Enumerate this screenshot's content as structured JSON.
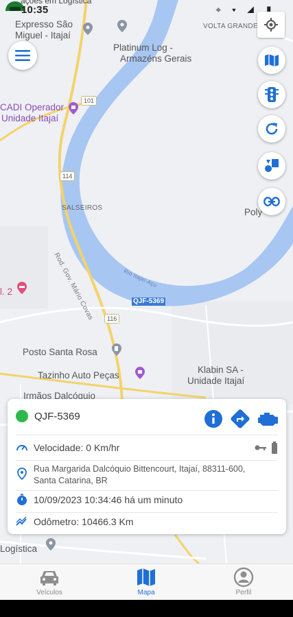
{
  "status_bar": {
    "time": "10:35",
    "icons": "⌖ ▾ ◢ ▮",
    "cut_label": "ações em Logística"
  },
  "map": {
    "labels": {
      "expresso": "Expresso São",
      "miguel": "Miguel - Itajaí",
      "platinum1": "Platinum Log -",
      "platinum2": "Armazéns Gerais",
      "volta": "VOLTA GRANDE",
      "cadi1": "CADI Operador",
      "cadi2": "Unidade Itajaí",
      "salseiros": "SALSEIROS",
      "poly": "Poly",
      "rod": "Rod. Gov. Mário Covas",
      "rio": "Rio Itajaí-Açu",
      "pink2": "l. 2",
      "posto": "Posto Santa Rosa",
      "tazinho": "Tazinho Auto Peças",
      "irmaos": "Irmãos Dalcóquio",
      "klabin1": "Klabin SA -",
      "klabin2": "Unidade Itajaí",
      "logistica": "Logística",
      "r101": "101",
      "r114": "114",
      "r116": "116"
    },
    "vehicle_plate_label": "QJF-5369"
  },
  "colors": {
    "river": "#a8c6f2",
    "accent": "#1f6fd6",
    "status_green": "#2eb84b",
    "road_yellow": "#f3d36b"
  },
  "card": {
    "plate": "QJF-5369",
    "speed": "Velocidade: 0 Km/hr",
    "address_line1": "Rua Margarida Dalcóquio Bittencourt, Itajaí, 88311-600,",
    "address_line2": "Santa Catarina, BR",
    "datetime": "10/09/2023 10:34:46  há um minuto",
    "odometer": "Odômetro: 10466.3 Km"
  },
  "bottom_nav": {
    "items": [
      {
        "label": "Veículos",
        "icon": "car-icon"
      },
      {
        "label": "Mapa",
        "icon": "map-icon"
      },
      {
        "label": "Perfil",
        "icon": "profile-icon"
      }
    ]
  }
}
